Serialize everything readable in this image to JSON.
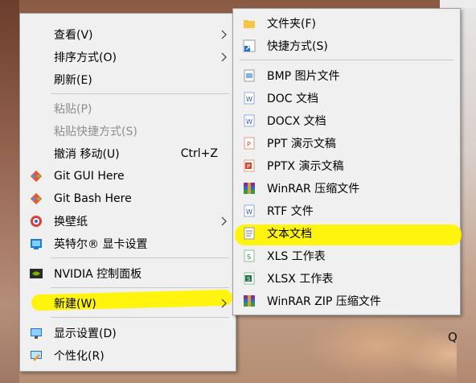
{
  "main_menu": {
    "items": [
      {
        "name": "view",
        "label": "查看(V)",
        "submenu": true
      },
      {
        "name": "sort-by",
        "label": "排序方式(O)",
        "submenu": true
      },
      {
        "name": "refresh",
        "label": "刷新(E)"
      },
      {
        "name": "paste",
        "label": "粘贴(P)",
        "disabled": true
      },
      {
        "name": "paste-shortcut",
        "label": "粘贴快捷方式(S)",
        "disabled": true
      },
      {
        "name": "undo-move",
        "label": "撤消 移动(U)",
        "shortcut": "Ctrl+Z"
      },
      {
        "name": "git-gui",
        "label": "Git GUI Here",
        "icon": "git-gui-icon"
      },
      {
        "name": "git-bash",
        "label": "Git Bash Here",
        "icon": "git-bash-icon"
      },
      {
        "name": "change-wallpaper",
        "label": "换壁纸",
        "icon": "wallpaper-icon",
        "submenu": true
      },
      {
        "name": "intel-graphics",
        "label": "英特尔® 显卡设置",
        "icon": "intel-graphics-icon"
      },
      {
        "name": "nvidia-control",
        "label": "NVIDIA 控制面板",
        "icon": "nvidia-icon"
      },
      {
        "name": "new",
        "label": "新建(W)",
        "submenu": true
      },
      {
        "name": "display-settings",
        "label": "显示设置(D)",
        "icon": "display-icon"
      },
      {
        "name": "personalize",
        "label": "个性化(R)",
        "icon": "personalize-icon"
      }
    ]
  },
  "sub_menu": {
    "items": [
      {
        "name": "folder",
        "label": "文件夹(F)",
        "icon": "folder-icon"
      },
      {
        "name": "shortcut",
        "label": "快捷方式(S)",
        "icon": "shortcut-icon"
      },
      {
        "name": "bmp",
        "label": "BMP 图片文件",
        "icon": "bmp-file-icon"
      },
      {
        "name": "doc",
        "label": "DOC 文档",
        "icon": "word-doc-icon"
      },
      {
        "name": "docx",
        "label": "DOCX 文档",
        "icon": "word-docx-icon"
      },
      {
        "name": "ppt",
        "label": "PPT 演示文稿",
        "icon": "ppt-icon"
      },
      {
        "name": "pptx",
        "label": "PPTX 演示文稿",
        "icon": "pptx-icon"
      },
      {
        "name": "winrar",
        "label": "WinRAR 压缩文件",
        "icon": "winrar-icon"
      },
      {
        "name": "rtf",
        "label": "RTF 文件",
        "icon": "rtf-icon"
      },
      {
        "name": "text-document",
        "label": "文本文档",
        "icon": "text-document-icon"
      },
      {
        "name": "xls",
        "label": "XLS 工作表",
        "icon": "xls-icon"
      },
      {
        "name": "xlsx",
        "label": "XLSX 工作表",
        "icon": "xlsx-icon"
      },
      {
        "name": "winrar-zip",
        "label": "WinRAR ZIP 压缩文件",
        "icon": "winrar-zip-icon"
      }
    ]
  },
  "desktop": {
    "letter": "Q"
  },
  "colors": {
    "highlight": "#fff300",
    "menu_bg": "#f0f0f0",
    "disabled_text": "#8d8d8d"
  }
}
